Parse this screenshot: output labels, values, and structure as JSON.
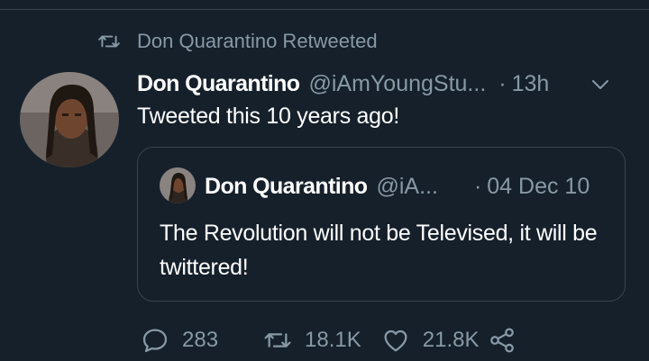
{
  "retweet": {
    "label": "Don Quarantino Retweeted"
  },
  "tweet": {
    "name": "Don Quarantino",
    "handle": "@iAmYoungStu...",
    "separator": "·",
    "time": "13h",
    "text": "Tweeted this 10 years ago!"
  },
  "quote": {
    "name": "Don Quarantino",
    "handle": "@iA...",
    "separator": "·",
    "date": "04 Dec 10",
    "text": "The Revolution will not be Televised, it will be twittered!"
  },
  "actions": {
    "replies": "283",
    "retweets": "18.1K",
    "likes": "21.8K"
  },
  "colors": {
    "background": "#15202b",
    "muted": "#8899a6",
    "border": "#38444d",
    "text": "#ffffff"
  }
}
